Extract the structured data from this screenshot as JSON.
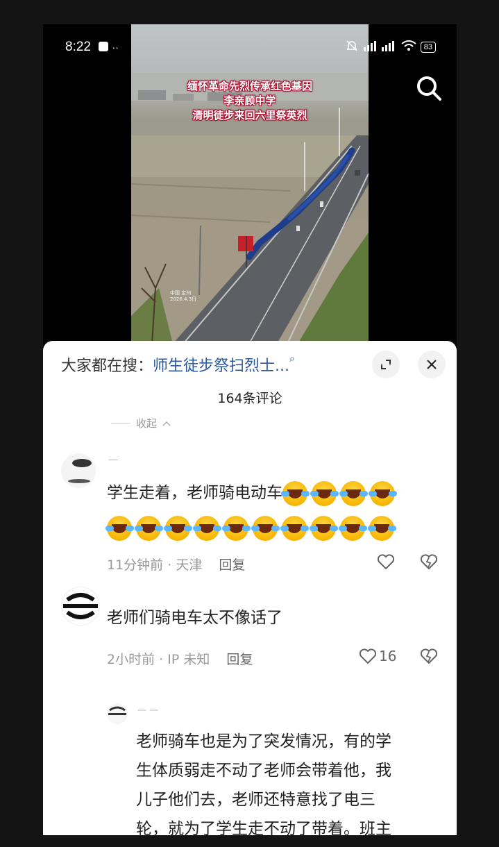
{
  "status_bar": {
    "time": "8:22",
    "signal": "5G 5G",
    "battery": "83"
  },
  "video": {
    "caption_lines": [
      "缅怀革命先烈传承红色基因",
      "李亲顾中学",
      "清明徒步来回六里祭英烈"
    ],
    "watermark_lines": [
      "中国 定州",
      "2026.4.3日"
    ]
  },
  "sheet": {
    "search_prefix": "大家都在搜：",
    "search_term": "师生徒步祭扫烈士...",
    "search_mag": "⌕",
    "comment_count": "164条评论",
    "collapse_label": "收起",
    "comments": [
      {
        "username": "一",
        "text": "学生走着，老师骑电动车",
        "emoji_count": 14,
        "time": "11分钟前",
        "location": "天津",
        "reply": "回复"
      },
      {
        "text": "老师们骑电车太不像话了",
        "time": "2小时前",
        "location": "IP 未知",
        "reply": "回复",
        "likes": "16"
      }
    ],
    "sub_comment": {
      "username": "一 一",
      "text_lines": [
        "老师骑车也是为了突发情况，有的学",
        "生体质弱走不动了老师会带着他，我",
        "儿子他们去，老师还特意找了电三",
        "轮，就为了学生走不动了带着。班主"
      ]
    }
  }
}
